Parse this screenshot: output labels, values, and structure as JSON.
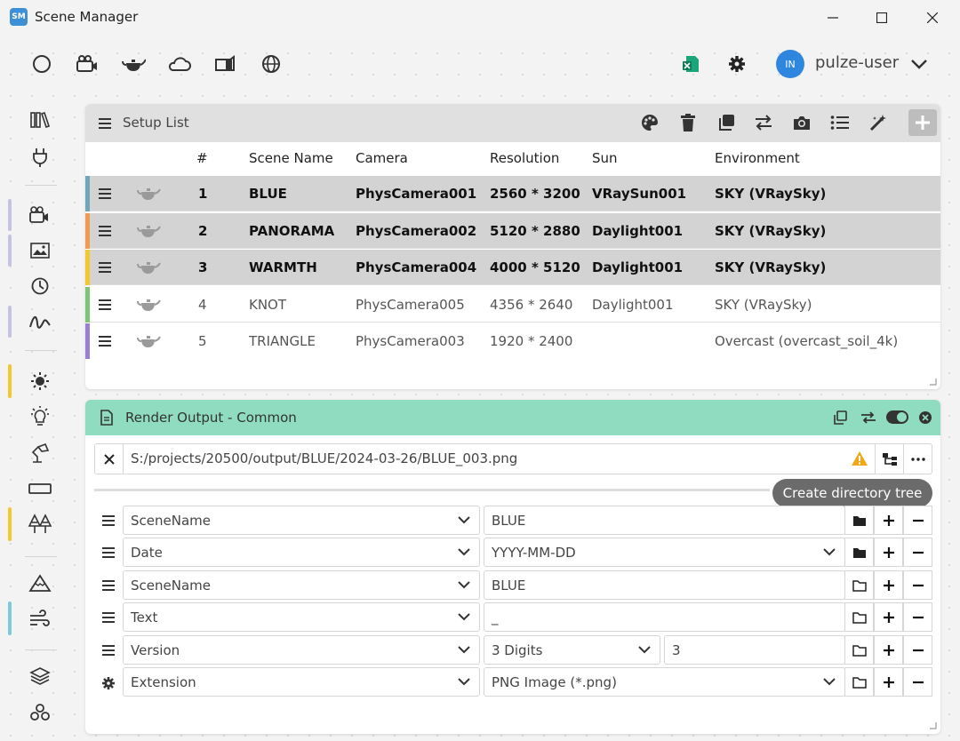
{
  "window": {
    "logo": "SM",
    "title": "Scene Manager"
  },
  "user": {
    "initials": "IN",
    "name": "pulze-user"
  },
  "setup_list": {
    "title": "Setup List",
    "columns": [
      "#",
      "Scene Name",
      "Camera",
      "Resolution",
      "Sun",
      "Environment"
    ],
    "rows": [
      {
        "num": "1",
        "scene": "BLUE",
        "camera": "PhysCamera001",
        "resolution": "2560 * 3200",
        "sun": "VRaySun001",
        "env": "SKY (VRaySky)",
        "selected": true,
        "color": "#6fa8b8"
      },
      {
        "num": "2",
        "scene": "PANORAMA",
        "camera": "PhysCamera002",
        "resolution": "5120 * 2880",
        "sun": "Daylight001",
        "env": "SKY (VRaySky)",
        "selected": true,
        "color": "#f39a52"
      },
      {
        "num": "3",
        "scene": "WARMTH",
        "camera": "PhysCamera004",
        "resolution": "4000 * 5120",
        "sun": "Daylight001",
        "env": "SKY (VRaySky)",
        "selected": true,
        "color": "#f3c72f"
      },
      {
        "num": "4",
        "scene": "KNOT",
        "camera": "PhysCamera005",
        "resolution": "4356 * 2640",
        "sun": "Daylight001",
        "env": "SKY (VRaySky)",
        "selected": false,
        "color": "#7cc576"
      },
      {
        "num": "5",
        "scene": "TRIANGLE",
        "camera": "PhysCamera003",
        "resolution": "1920 * 2400",
        "sun": "",
        "env": "Overcast (overcast_soil_4k)",
        "selected": false,
        "color": "#9b7fd6"
      }
    ]
  },
  "render_output": {
    "title": "Render Output - Common",
    "path": "S:/projects/20500/output/BLUE/2024-03-26/BLUE_003.png",
    "tooltip": "Create directory tree",
    "rows": [
      {
        "token": "SceneName",
        "value": "BLUE",
        "value_has_dropdown": false,
        "extra": "",
        "folder": "filled",
        "lead": "drag"
      },
      {
        "token": "Date",
        "value": "YYYY-MM-DD",
        "value_has_dropdown": true,
        "extra": "",
        "folder": "filled",
        "lead": "drag"
      },
      {
        "token": "SceneName",
        "value": "BLUE",
        "value_has_dropdown": false,
        "extra": "",
        "folder": "outline",
        "lead": "drag"
      },
      {
        "token": "Text",
        "value": "_",
        "value_has_dropdown": false,
        "extra": "",
        "folder": "outline",
        "lead": "drag"
      },
      {
        "token": "Version",
        "value": "3 Digits",
        "value_has_dropdown": true,
        "extra": "3",
        "folder": "outline",
        "lead": "drag"
      },
      {
        "token": "Extension",
        "value": "PNG Image (*.png)",
        "value_has_dropdown": true,
        "extra": "",
        "folder": "outline",
        "lead": "gear"
      }
    ]
  },
  "colors": {
    "accent_green": "#8fdcc0",
    "warning": "#f0a818",
    "avatar": "#2e86de",
    "selected_row": "#d3d3d3"
  },
  "icons": {
    "toolbar": [
      "circle-icon",
      "camera-icon",
      "teapot-icon",
      "cloud-icon",
      "box-icon",
      "globe-icon",
      "export-excel-icon",
      "gear-icon",
      "chevron-down-icon"
    ],
    "sidebar": [
      "library-icon",
      "plug-icon",
      "camera-icon",
      "image-icon",
      "clock-icon",
      "curve-icon",
      "sun-icon",
      "bulb-icon",
      "lamp-icon",
      "frame-icon",
      "trees-icon",
      "mountain-icon",
      "wind-icon",
      "layers-icon",
      "objects-icon"
    ],
    "setup_list_header": [
      "palette-icon",
      "trash-icon",
      "copy-icon",
      "swap-icon",
      "camera-icon",
      "list-icon",
      "magic-wand-icon",
      "add-icon"
    ],
    "render_output_header": [
      "copy-icon",
      "swap-icon",
      "toggle-icon",
      "close-circle-icon"
    ]
  }
}
